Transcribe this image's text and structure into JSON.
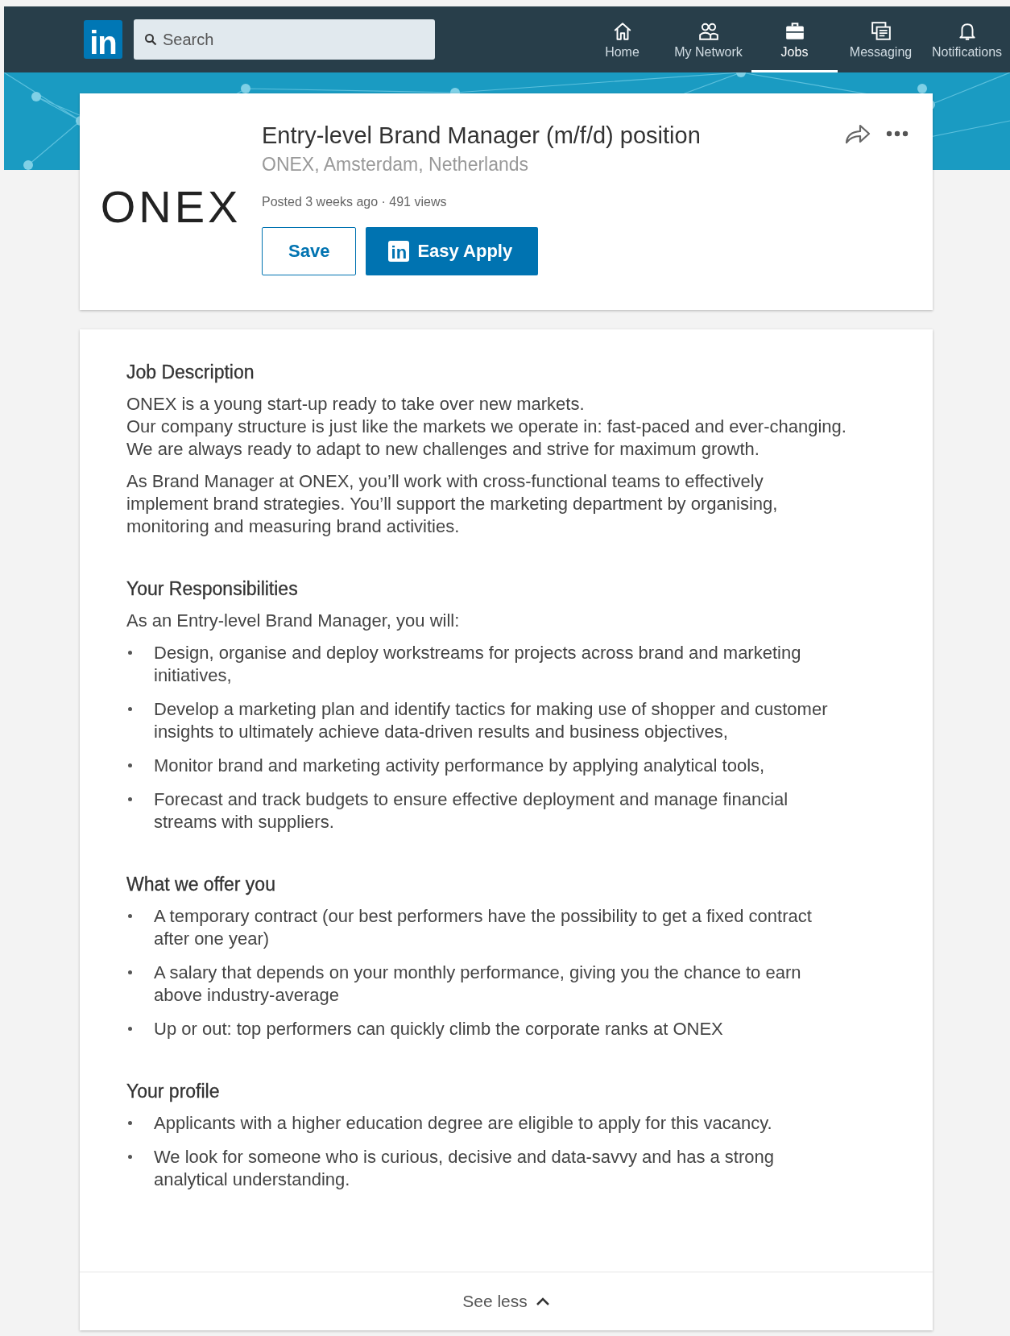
{
  "nav": {
    "logo": "in",
    "search": {
      "placeholder": "Search"
    },
    "items": [
      {
        "label": "Home",
        "kind": "home",
        "selected": false
      },
      {
        "label": "My Network",
        "kind": "network",
        "selected": false
      },
      {
        "label": "Jobs",
        "kind": "jobs",
        "selected": true
      },
      {
        "label": "Messaging",
        "kind": "messaging",
        "selected": false
      },
      {
        "label": "Notifications",
        "kind": "notifications",
        "selected": false
      }
    ]
  },
  "job": {
    "logo": "ONEX",
    "title": "Entry-level Brand Manager (m/f/d) position",
    "location": "ONEX, Amsterdam, Netherlands",
    "meta": "Posted 3 weeks ago · 491 views",
    "buttons": [
      {
        "label": "Save",
        "kind": "secondary"
      },
      {
        "label": "Easy Apply",
        "kind": "primary",
        "badge": "in"
      }
    ]
  },
  "description": {
    "sections": [
      {
        "heading": "Job Description",
        "blocks": [
          {
            "kind": "lines",
            "lines": [
              "ONEX is a young start-up ready to take over new markets.",
              "Our company structure is just like the markets we operate in: fast-paced and ever-changing.",
              "We are always ready to adapt to new challenges and strive for maximum growth."
            ]
          },
          {
            "kind": "paragraph",
            "text": "As Brand Manager at ONEX, you’ll work with cross-functional teams to effectively implement brand strategies. You’ll support the marketing department by organising, monitoring and measuring brand activities."
          }
        ]
      },
      {
        "heading": "Your Responsibilities",
        "blocks": [
          {
            "kind": "paragraph",
            "text": "As an Entry-level Brand Manager, you will:"
          },
          {
            "kind": "list",
            "items": [
              "Design, organise and deploy workstreams for projects across brand and marketing initiatives,",
              "Develop a marketing plan and identify tactics for making use of shopper and customer insights to ultimately achieve data-driven results and business objectives,",
              "Monitor brand and marketing activity performance by applying analytical tools,",
              "Forecast and track budgets to ensure effective deployment and manage financial streams with suppliers."
            ]
          }
        ]
      },
      {
        "heading": "What we offer you",
        "blocks": [
          {
            "kind": "list",
            "items": [
              "A temporary contract (our best performers have the possibility to get a fixed contract after one year)",
              "A salary that depends on your monthly performance, giving you the chance to earn above industry-average",
              "Up or out: top performers can quickly climb the corporate ranks at ONEX"
            ]
          }
        ]
      },
      {
        "heading": "Your profile",
        "blocks": [
          {
            "kind": "list",
            "items": [
              "Applicants with a higher education degree are eligible to apply for this vacancy.",
              "We look for someone who is curious, decisive and data-savvy and has a strong analytical understanding."
            ]
          }
        ]
      }
    ]
  },
  "footer": {
    "label": "See less"
  }
}
